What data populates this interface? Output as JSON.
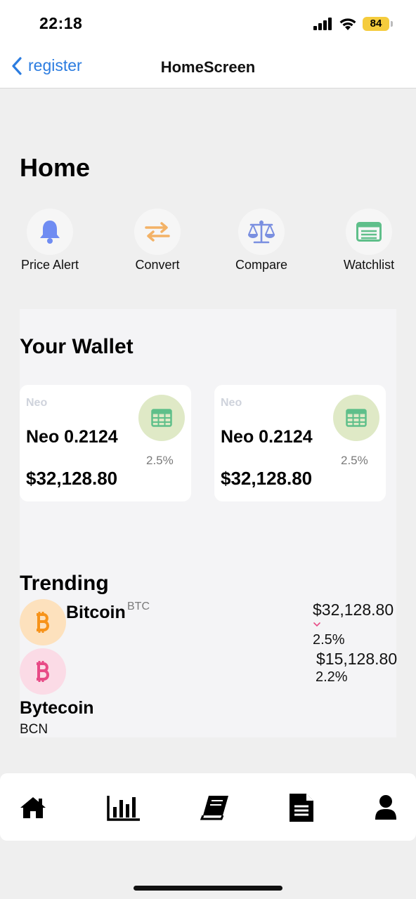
{
  "status_bar": {
    "time": "22:18",
    "battery": "84"
  },
  "nav": {
    "back_label": "register",
    "title": "HomeScreen"
  },
  "home": {
    "title": "Home"
  },
  "quick_actions": [
    {
      "label": "Price Alert",
      "icon": "bell-icon"
    },
    {
      "label": "Convert",
      "icon": "convert-arrows-icon"
    },
    {
      "label": "Compare",
      "icon": "scales-icon"
    },
    {
      "label": "Watchlist",
      "icon": "list-card-icon"
    }
  ],
  "wallet": {
    "title": "Your Wallet",
    "cards": [
      {
        "ticker": "Neo",
        "amount": "Neo 0.2124",
        "value": "$32,128.80",
        "change": "2.5%",
        "icon": "table-icon"
      },
      {
        "ticker": "Neo",
        "amount": "Neo 0.2124",
        "value": "$32,128.80",
        "change": "2.5%",
        "icon": "table-icon"
      }
    ]
  },
  "trending": {
    "title": "Trending",
    "coins": [
      {
        "name": "Bitcoin",
        "ticker": "BTC",
        "price": "$32,128.80",
        "change": "2.5%",
        "icon": "bitcoin-icon",
        "color": "#f7931a"
      },
      {
        "name": "Bytecoin",
        "ticker": "BCN",
        "price": "$15,128.80",
        "change": "2.2%",
        "icon": "bitcoin-icon",
        "color": "#e84a86"
      }
    ]
  },
  "tab_bar": {
    "items": [
      {
        "icon": "home-icon"
      },
      {
        "icon": "bar-chart-icon"
      },
      {
        "icon": "book-icon"
      },
      {
        "icon": "document-icon"
      },
      {
        "icon": "user-icon"
      }
    ]
  },
  "colors": {
    "accent": "#2b7ce0",
    "bell": "#6f8cf2",
    "convert": "#f3b266",
    "compare": "#7a8fe0",
    "watchlist": "#5fbf8a",
    "wallet_icon_bg": "#dfe9c6",
    "wallet_icon": "#5fbf8a",
    "down_arrow": "#e84a86"
  }
}
